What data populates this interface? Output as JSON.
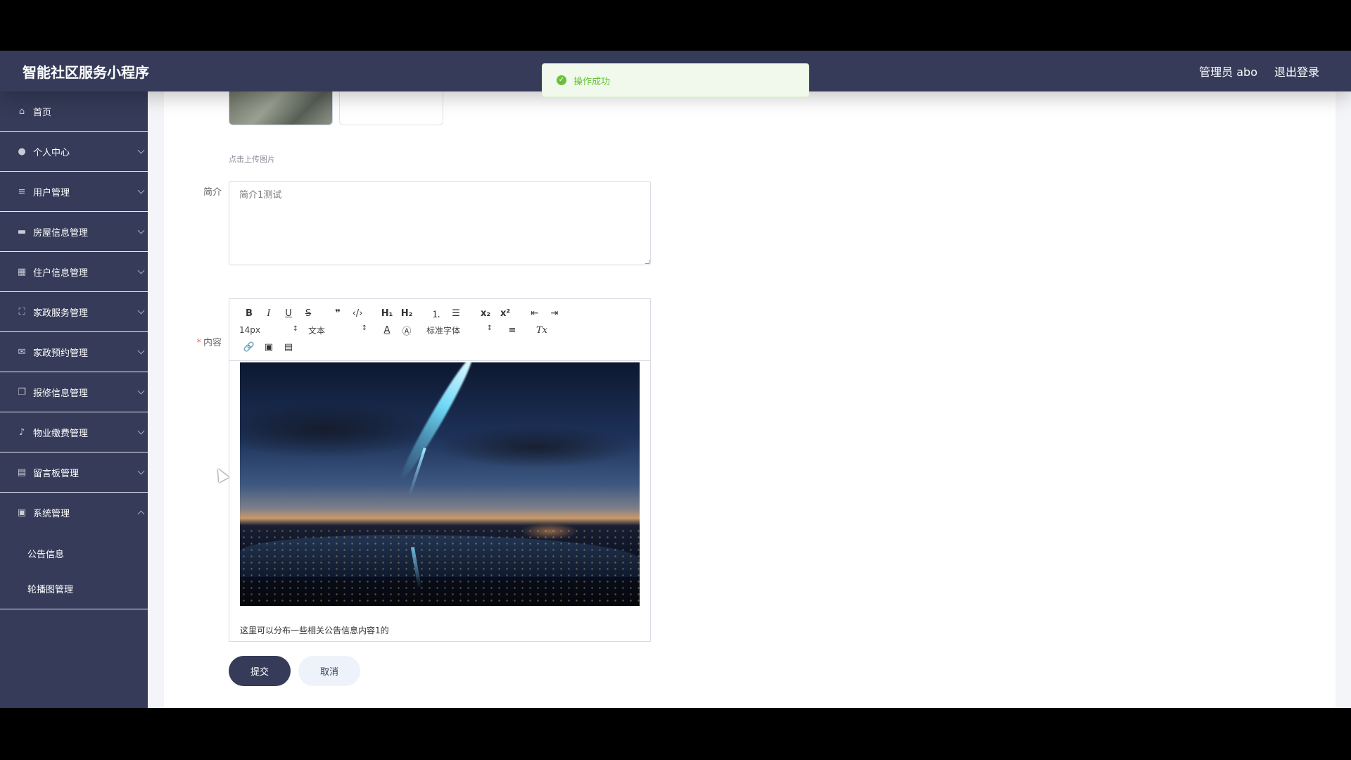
{
  "header": {
    "title": "智能社区服务小程序",
    "user_label": "管理员 abo",
    "logout_label": "退出登录"
  },
  "toast": {
    "message": "操作成功",
    "icon": "check-circle-icon",
    "color": "#67c23a"
  },
  "sidebar": {
    "items": [
      {
        "label": "首页",
        "icon": "home-icon"
      },
      {
        "label": "个人中心",
        "icon": "user-icon"
      },
      {
        "label": "用户管理",
        "icon": "list-icon"
      },
      {
        "label": "房屋信息管理",
        "icon": "ticket-icon"
      },
      {
        "label": "住户信息管理",
        "icon": "grid-icon"
      },
      {
        "label": "家政服务管理",
        "icon": "expand-icon"
      },
      {
        "label": "家政预约管理",
        "icon": "mail-icon"
      },
      {
        "label": "报修信息管理",
        "icon": "copy-icon"
      },
      {
        "label": "物业缴费管理",
        "icon": "mic-icon"
      },
      {
        "label": "留言板管理",
        "icon": "apps-icon"
      },
      {
        "label": "系统管理",
        "icon": "clipboard-icon"
      }
    ],
    "sub_items": [
      "公告信息",
      "轮播图管理"
    ]
  },
  "form": {
    "upload_tip": "点击上传图片",
    "intro_label": "简介",
    "intro_value": "简介1测试",
    "content_label": "内容",
    "content_required_mark": "*",
    "editor": {
      "font_size": "14px",
      "text_type": "文本",
      "font_family": "标准字体",
      "body_text": "这里可以分布一些相关公告信息内容1的"
    },
    "submit_label": "提交",
    "cancel_label": "取消"
  },
  "colors": {
    "primary": "#353b58",
    "success": "#67c23a",
    "cancel_bg": "#eef3fb"
  }
}
